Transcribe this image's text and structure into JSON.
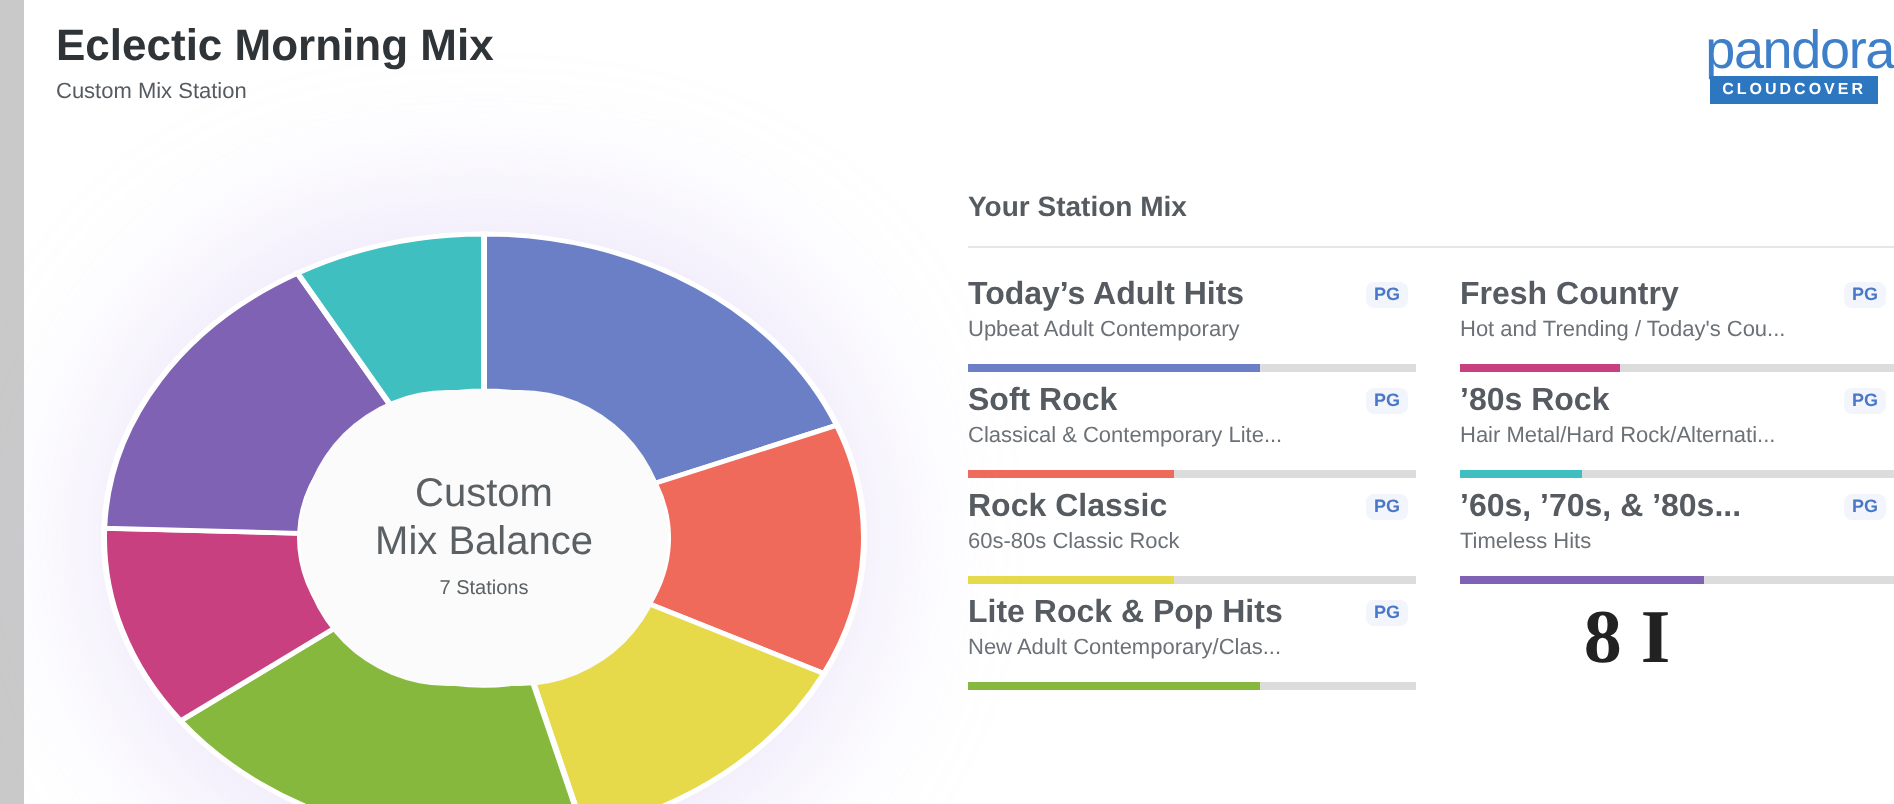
{
  "header": {
    "title": "Eclectic Morning Mix",
    "subtitle": "Custom Mix Station"
  },
  "logo": {
    "wordmark": "pandora",
    "badge": "CLOUDCOVER"
  },
  "donut": {
    "title": "Custom",
    "title_line2": "Mix Balance",
    "caption": "7 Stations"
  },
  "station_mix": {
    "heading": "Your Station Mix",
    "stations": [
      {
        "name": "Today’s Adult Hits",
        "rating": "PG",
        "description": "Upbeat Adult Contemporary",
        "level": 0.65,
        "color": "#6a7fc6"
      },
      {
        "name": "Fresh Country",
        "rating": "PG",
        "description": "Hot and Trending / Today's Cou...",
        "level": 0.37,
        "color": "#c8407f"
      },
      {
        "name": "Soft Rock",
        "rating": "PG",
        "description": "Classical & Contemporary Lite...",
        "level": 0.46,
        "color": "#ef6a5a"
      },
      {
        "name": "’80s Rock",
        "rating": "PG",
        "description": "Hair Metal/Hard Rock/Alternati...",
        "level": 0.28,
        "color": "#3fbfbf"
      },
      {
        "name": "Rock Classic",
        "rating": "PG",
        "description": "60s-80s Classic Rock",
        "level": 0.46,
        "color": "#e6da4a"
      },
      {
        "name": "’60s, ’70s, & ’80s...",
        "rating": "PG",
        "description": "Timeless Hits",
        "level": 0.56,
        "color": "#7f62b3"
      },
      {
        "name": "Lite Rock & Pop Hits",
        "rating": "PG",
        "description": "New Adult Contemporary/Clas...",
        "level": 0.65,
        "color": "#86b83e"
      }
    ]
  },
  "overlay_text": "8 I"
}
